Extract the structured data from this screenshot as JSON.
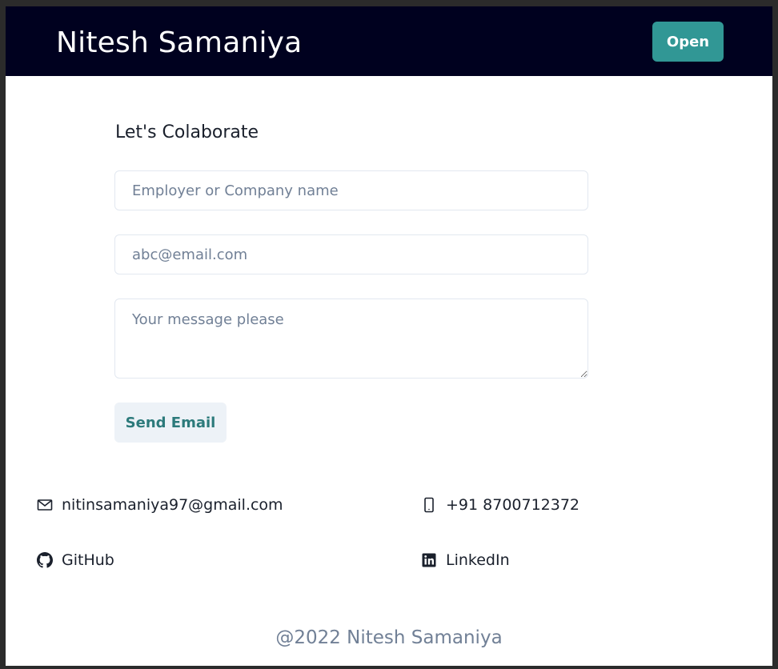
{
  "header": {
    "brand": "Nitesh Samaniya",
    "open_label": "Open"
  },
  "form": {
    "title": "Let's Colaborate",
    "name_placeholder": "Employer or Company name",
    "email_placeholder": "abc@email.com",
    "message_placeholder": "Your message please",
    "send_label": "Send Email"
  },
  "contacts": {
    "email": {
      "label": "nitinsamaniya97@gmail.com",
      "icon": "mail-icon"
    },
    "phone": {
      "label": "+91 8700712372",
      "icon": "phone-icon"
    },
    "github": {
      "label": "GitHub",
      "icon": "github-icon"
    },
    "linkedin": {
      "label": "LinkedIn",
      "icon": "linkedin-icon"
    }
  },
  "footer": {
    "text": "@2022 Nitesh Samaniya"
  },
  "colors": {
    "header_bg": "#00011f",
    "accent": "#319795",
    "send_text": "#2c7a7b",
    "send_bg": "#edf2f7"
  }
}
